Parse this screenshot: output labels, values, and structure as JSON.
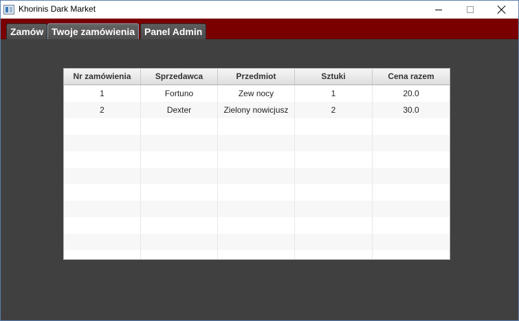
{
  "window": {
    "title": "Khorinis Dark Market"
  },
  "tabs": [
    {
      "label": "Zamów"
    },
    {
      "label": "Twoje zamówienia"
    },
    {
      "label": "Panel Admin"
    }
  ],
  "table": {
    "columns": [
      "Nr zamówienia",
      "Sprzedawca",
      "Przedmiot",
      "Sztuki",
      "Cena razem"
    ],
    "rows": [
      [
        "1",
        "Fortuno",
        "Zew nocy",
        "1",
        "20.0"
      ],
      [
        "2",
        "Dexter",
        "Zielony nowicjusz",
        "2",
        "30.0"
      ]
    ]
  },
  "colors": {
    "tab_bar": "#7a0000",
    "content_bg": "#404040"
  },
  "icons": {
    "app": "app-window-icon",
    "minimize": "minimize-icon",
    "maximize": "maximize-icon",
    "close": "close-icon"
  }
}
